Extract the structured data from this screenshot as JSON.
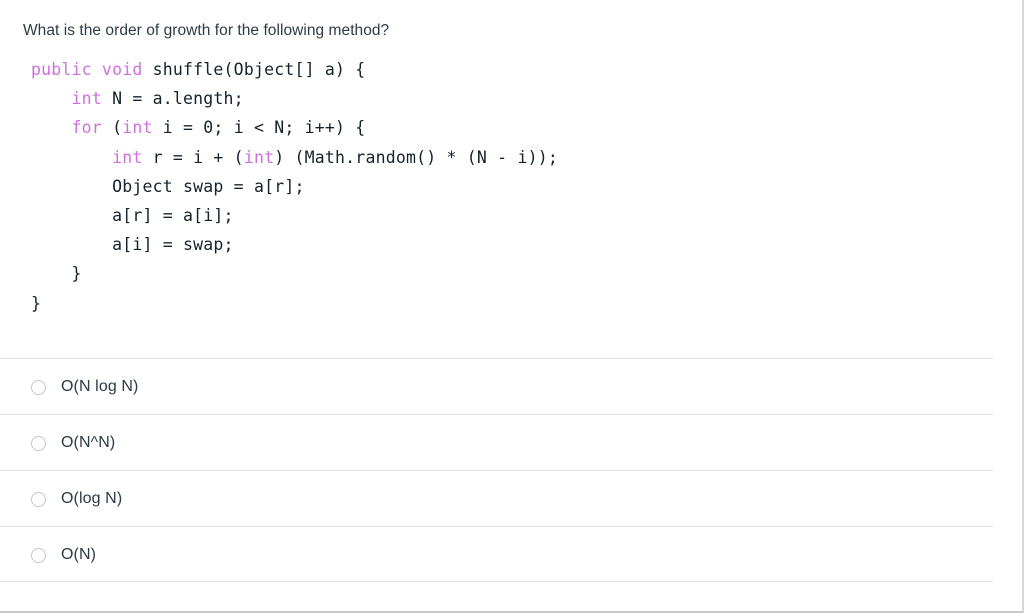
{
  "question": {
    "prompt": "What is the order of growth for the following method?",
    "code_lines": [
      [
        {
          "t": "public void ",
          "k": true
        },
        {
          "t": "shuffle(Object[] a) {",
          "k": false
        }
      ],
      [
        {
          "t": "    int ",
          "k": true
        },
        {
          "t": "N = a.length;",
          "k": false
        }
      ],
      [
        {
          "t": "    for ",
          "k": true
        },
        {
          "t": "(",
          "k": false
        },
        {
          "t": "int ",
          "k": true
        },
        {
          "t": "i = 0; i < N; i++) {",
          "k": false
        }
      ],
      [
        {
          "t": "        int ",
          "k": true
        },
        {
          "t": "r = i + (",
          "k": false
        },
        {
          "t": "int",
          "k": true
        },
        {
          "t": ") (Math.random() * (N - i));",
          "k": false
        }
      ],
      [
        {
          "t": "        Object swap = a[r];",
          "k": false
        }
      ],
      [
        {
          "t": "        a[r] = a[i];",
          "k": false
        }
      ],
      [
        {
          "t": "        a[i] = swap;",
          "k": false
        }
      ],
      [
        {
          "t": "    }",
          "k": false
        }
      ],
      [
        {
          "t": "}",
          "k": false
        }
      ]
    ]
  },
  "answers": {
    "options": [
      {
        "label": "O(N log N)",
        "selected": false
      },
      {
        "label": "O(N^N)",
        "selected": false
      },
      {
        "label": "O(log N)",
        "selected": false
      },
      {
        "label": "O(N)",
        "selected": false
      }
    ]
  },
  "colors": {
    "text": "#2d3b45",
    "keyword": "#d070e0",
    "code_text": "#16212b",
    "separator": "#e3e3e3",
    "radio_border": "#c7c7c7",
    "page_border": "#d6d6d6"
  }
}
